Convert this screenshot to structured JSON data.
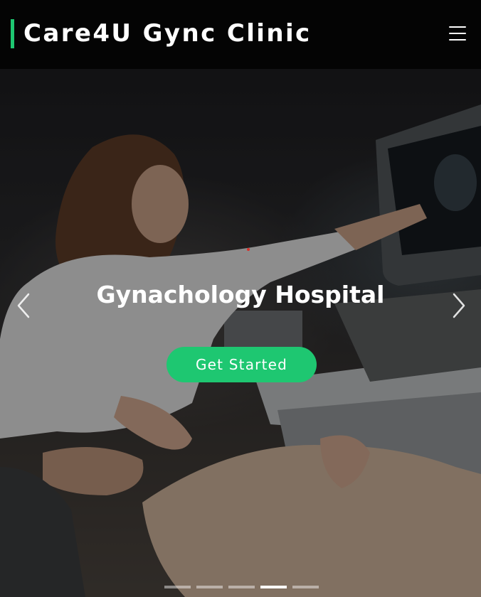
{
  "header": {
    "brand": "Care4U Gync Clinic",
    "menu_icon": "hamburger-menu-icon"
  },
  "hero": {
    "title": "Gynachology Hospital",
    "cta_label": "Get Started",
    "prev_icon": "chevron-left-icon",
    "next_icon": "chevron-right-icon",
    "image": "doctor-ultrasound-photo",
    "slides_total": 5,
    "active_slide": 4
  },
  "colors": {
    "accent": "#1ec771",
    "header_bg": "#040404",
    "text": "#ffffff"
  }
}
